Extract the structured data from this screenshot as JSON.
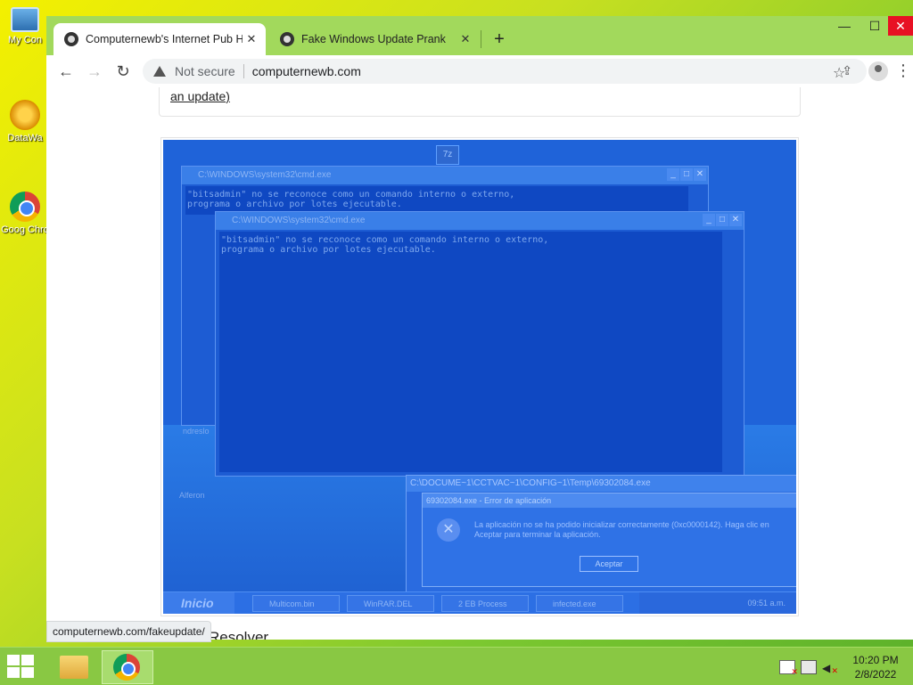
{
  "desktop": {
    "icons": [
      {
        "label": "My Con",
        "icon": "computer-icon"
      },
      {
        "label": "DataWa",
        "icon": "datawa-icon"
      },
      {
        "label": "Goog Chro",
        "icon": "chrome-icon"
      }
    ]
  },
  "browser": {
    "tabs": [
      {
        "title": "Computernewb's Internet Pub H",
        "close": "✕",
        "active": true
      },
      {
        "title": "Fake Windows Update Prank",
        "close": "✕",
        "active": false
      }
    ],
    "new_tab": "+",
    "window_controls": {
      "minimize": "—",
      "maximize": "☐",
      "close": "✕"
    },
    "toolbar": {
      "back": "←",
      "forward": "→",
      "reload": "↻"
    },
    "omnibox": {
      "security_label": "Not secure",
      "url": "computernewb.com"
    },
    "status_url": "computernewb.com/fakeupdate/"
  },
  "page": {
    "top_link_text": "an update)",
    "section_heading_peek": "Resolver",
    "embedded_screenshot": {
      "icon_label": "7z",
      "cmd_window_1": {
        "title": "C:\\WINDOWS\\system32\\cmd.exe",
        "body": "\"bitsadmin\" no se reconoce como un comando interno o externo,\nprograma o archivo por lotes ejecutable."
      },
      "cmd_window_2": {
        "title": "C:\\WINDOWS\\system32\\cmd.exe",
        "body": "\"bitsadmin\" no se reconoce como un comando interno o externo,\nprograma o archivo por lotes ejecutable."
      },
      "misc_label_1": "ndreslo",
      "misc_label_2": "Alferon",
      "error_window_title": "C:\\DOCUME~1\\CCTVAC~1\\CONFIG~1\\Temp\\69302084.exe",
      "error_dialog": {
        "title": "69302084.exe - Error de aplicación",
        "message": "La aplicación no se ha podido inicializar correctamente (0xc0000142). Haga clic en Aceptar para terminar la aplicación.",
        "ok_label": "Aceptar"
      },
      "taskbar": {
        "start_label": "Inicio",
        "items": [
          "Multicom.bin",
          "WinRAR.DEL",
          "2 EB Process",
          "infected.exe"
        ],
        "clock": "09:51 a.m."
      }
    }
  },
  "taskbar": {
    "clock_time": "10:20 PM",
    "clock_date": "2/8/2022"
  },
  "colors": {
    "taskbar": "#89c843",
    "tabstrip": "#a2d95c",
    "close_button": "#e81123",
    "embedded_overlay": "#1f63d9"
  }
}
